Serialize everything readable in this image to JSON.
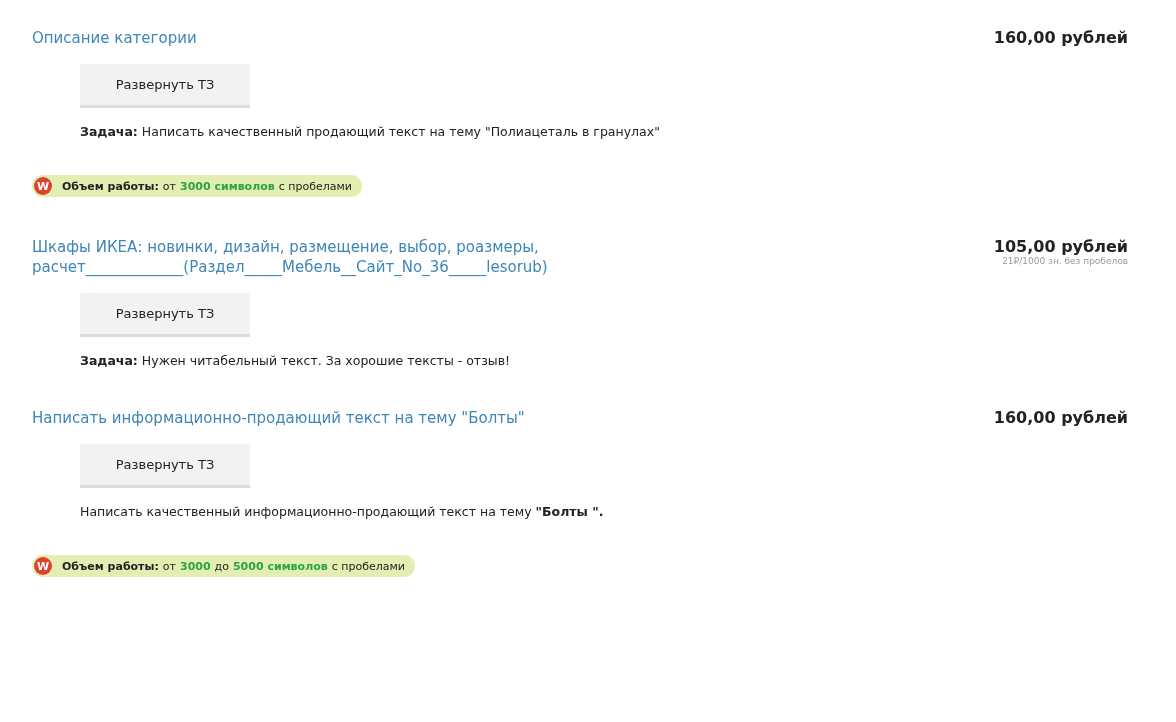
{
  "orders": [
    {
      "title": "Описание категории",
      "price": "160,00 рублей",
      "button": "Развернуть ТЗ",
      "task": "**Задача:** Написать качественный продающий текст на тему \"Полиацеталь в гранулах\"",
      "volume": {
        "icon_letter": "W",
        "parts": [
          {
            "kind": "label",
            "text": "Объем работы:"
          },
          {
            "kind": "plain",
            "text": "от"
          },
          {
            "kind": "accent",
            "text": "3000 символов"
          },
          {
            "kind": "plain",
            "text": "с пробелами"
          }
        ]
      }
    },
    {
      "title": "Шкафы ИКЕА: новинки, дизайн, размещение, выбор, роазмеры, расчет_____________(Раздел_____Мебель__Сайт_No_36_____lesorub)",
      "price": "105,00 рублей",
      "price_note": "21₽/1000 зн. без пробелов",
      "button": "Развернуть ТЗ",
      "task": "**Задача:** Нужен читабельный текст. За хорошие тексты - отзыв!"
    },
    {
      "title": "Написать информационно-продающий текст на тему \"Болты\"",
      "price": "160,00 рублей",
      "button": "Развернуть ТЗ",
      "task": "Написать качественный информационно-продающий текст на тему **\"Болты \".**",
      "volume": {
        "icon_letter": "W",
        "parts": [
          {
            "kind": "label",
            "text": "Объем работы:"
          },
          {
            "kind": "plain",
            "text": "от"
          },
          {
            "kind": "accent",
            "text": "3000"
          },
          {
            "kind": "plain",
            "text": "до"
          },
          {
            "kind": "accent",
            "text": "5000 символов"
          },
          {
            "kind": "plain",
            "text": "с пробелами"
          }
        ]
      }
    }
  ]
}
